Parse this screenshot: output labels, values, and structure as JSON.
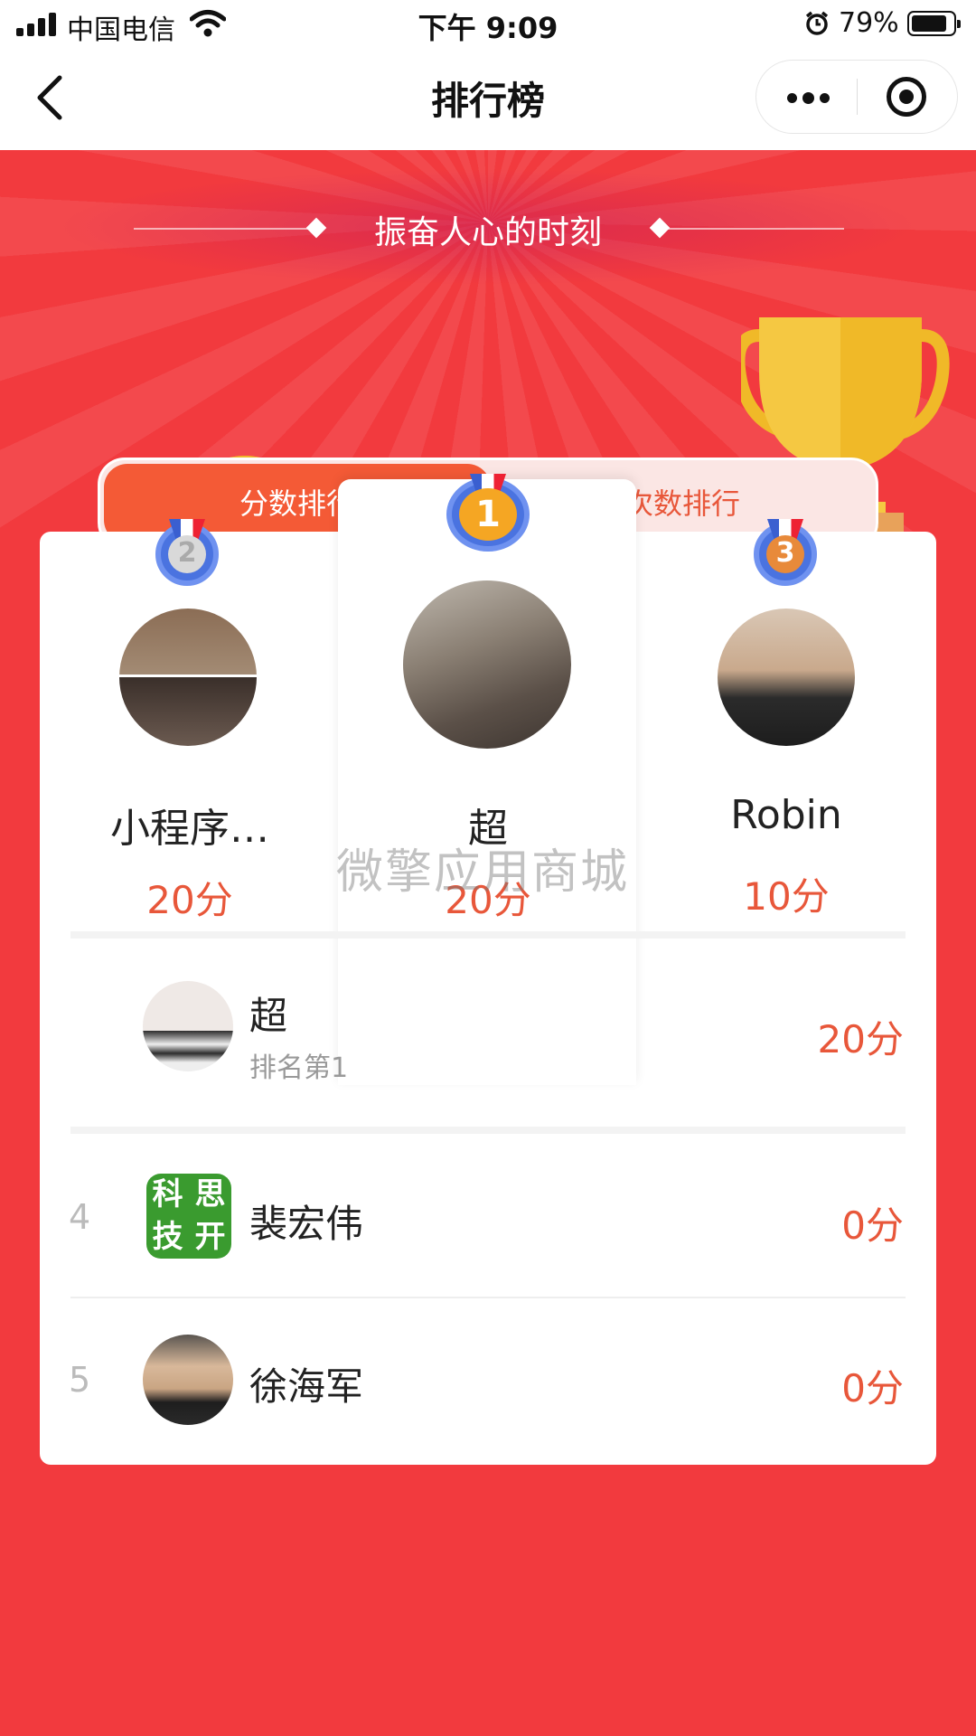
{
  "status_bar": {
    "carrier": "中国电信",
    "time": "下午 9:09",
    "battery_percent": "79%",
    "battery_level": 0.79,
    "icons": [
      "signal-icon",
      "wifi-icon",
      "alarm-icon",
      "battery-icon"
    ]
  },
  "nav": {
    "title": "排行榜",
    "icons": [
      "back-icon",
      "more-icon",
      "close-target-icon"
    ]
  },
  "hero": {
    "slogan": "振奋人心的时刻",
    "coin_symbol": "¥"
  },
  "tabs": [
    {
      "label": "分数排行",
      "active": true
    },
    {
      "label": "次数排行",
      "active": false
    }
  ],
  "podium": {
    "second": {
      "rank": "2",
      "name": "小程序…",
      "score": "20分"
    },
    "first": {
      "rank": "1",
      "name": "超",
      "score": "20分"
    },
    "third": {
      "rank": "3",
      "name": "Robin",
      "score": "10分"
    }
  },
  "watermark": "微擎应用商城",
  "my_rank": {
    "name": "超",
    "subtitle": "排名第1",
    "score": "20分"
  },
  "list": [
    {
      "rank": "4",
      "name": "裴宏伟",
      "score": "0分",
      "logo_text": [
        "科",
        "思",
        "技",
        "开"
      ]
    },
    {
      "rank": "5",
      "name": "徐海军",
      "score": "0分"
    }
  ],
  "colors": {
    "background": "#f23a3e",
    "accent": "#f45a36",
    "score": "#e8573a",
    "tab_inactive_bg": "#fbe6e4"
  }
}
